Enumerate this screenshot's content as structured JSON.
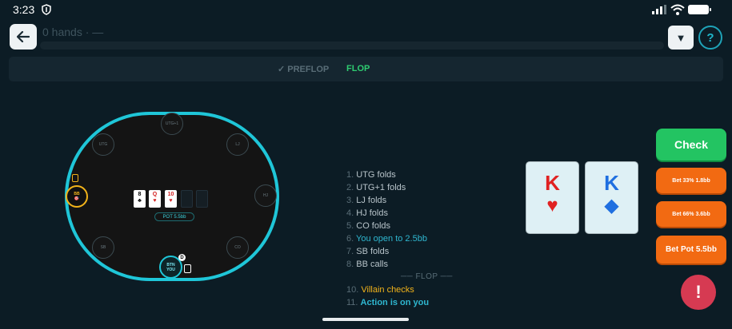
{
  "status_bar": {
    "time": "3:23"
  },
  "header": {
    "hands_label": "0 hands · —",
    "filter_label": "▼",
    "help_label": "?"
  },
  "streets": {
    "preflop": "✓ PREFLOP",
    "flop": "FLOP"
  },
  "table": {
    "seats": {
      "utg1": "UTG+1",
      "utg": "UTG",
      "lj": "LJ",
      "hj": "HJ",
      "co": "CO",
      "sb": "SB",
      "bb": "BB",
      "bb_sub": "🎯",
      "btn": "BTN",
      "btn_sub": "YOU"
    },
    "dealer_label": "D",
    "board": [
      {
        "rank": "8",
        "suit": "♣"
      },
      {
        "rank": "Q",
        "suit": "♥"
      },
      {
        "rank": "10",
        "suit": "♥"
      }
    ],
    "pot": "POT 5.5bb"
  },
  "action_log": {
    "rows": [
      {
        "num": "1.",
        "text": "UTG folds"
      },
      {
        "num": "2.",
        "text": "UTG+1 folds"
      },
      {
        "num": "3.",
        "text": "LJ folds"
      },
      {
        "num": "4.",
        "text": "HJ folds"
      },
      {
        "num": "5.",
        "text": "CO folds"
      },
      {
        "num": "6.",
        "text": "You open to 2.5bb"
      },
      {
        "num": "7.",
        "text": "SB folds"
      },
      {
        "num": "8.",
        "text": "BB calls"
      }
    ],
    "divider": "── FLOP ──",
    "flop_rows": [
      {
        "num": "10.",
        "text": "Villain checks"
      },
      {
        "num": "11.",
        "text": "Action is on you"
      }
    ]
  },
  "hero_cards": [
    {
      "rank": "K",
      "suit": "♥"
    },
    {
      "rank": "K",
      "suit": "◆"
    }
  ],
  "actions": {
    "check": "Check",
    "bet_33": "Bet 33% 1.8bb",
    "bet_66": "Bet 66% 3.6bb",
    "bet_pot": "Bet Pot 5.5bb"
  },
  "report_label": "!",
  "colors": {
    "background": "#0c1c25",
    "table_rail": "#1fc6d8",
    "check_green": "#23c462",
    "bet_orange": "#f26a12",
    "hero_blue": "#2fb7d0",
    "villain_yellow": "#f2b31a"
  }
}
